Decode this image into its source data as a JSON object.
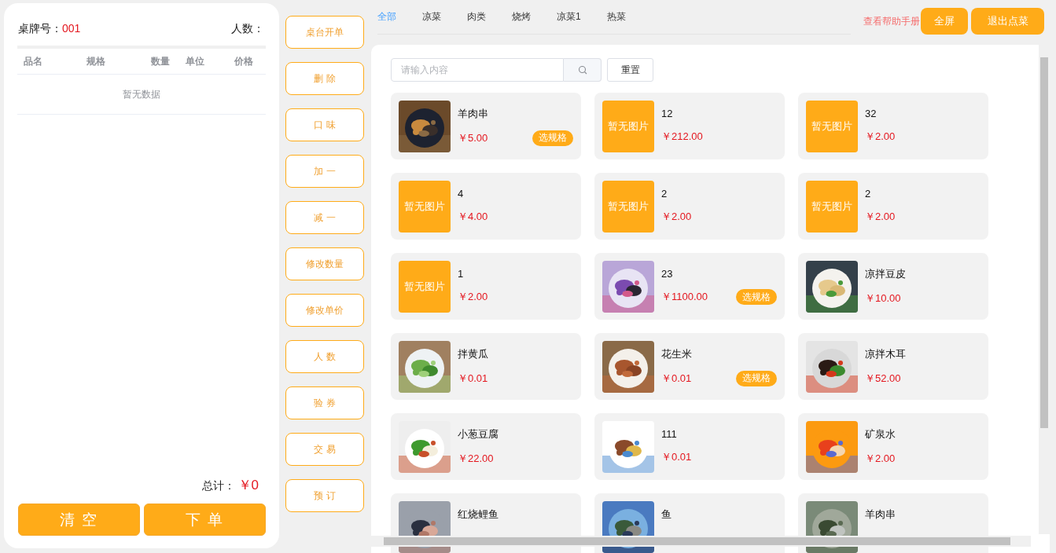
{
  "cart": {
    "table_label": "桌牌号：",
    "table_no": "001",
    "people_label": "人数：",
    "columns": [
      "品名",
      "规格",
      "数量",
      "单位",
      "价格"
    ],
    "empty_text": "暂无数据",
    "total_label": "总计：",
    "total": "￥0",
    "buttons": [
      "清 空",
      "下 单"
    ]
  },
  "actions": [
    "桌台开单",
    "删 除",
    "口 味",
    "加 一",
    "减 一",
    "修改数量",
    "修改单价",
    "人 数",
    "验 券",
    "交 易",
    "预 订"
  ],
  "tabs": [
    {
      "label": "全部",
      "selected": true
    },
    {
      "label": "凉菜",
      "selected": false
    },
    {
      "label": "肉类",
      "selected": false
    },
    {
      "label": "烧烤",
      "selected": false
    },
    {
      "label": "凉菜1",
      "selected": false
    },
    {
      "label": "热菜",
      "selected": false
    }
  ],
  "help_link": "查看帮助手册",
  "top_buttons": [
    "全屏",
    "退出点菜"
  ],
  "search": {
    "placeholder": "请输入内容",
    "reset": "重置"
  },
  "dishes": [
    {
      "name": "羊肉串",
      "price": "￥5.00",
      "spec": "选规格"
    },
    {
      "image": {
        "kind": "placeholder",
        "text": "暂无图片"
      },
      "name": "12",
      "price": "￥212.00"
    },
    {
      "image": {
        "kind": "placeholder",
        "text": "暂无图片"
      },
      "name": "32",
      "price": "￥2.00"
    },
    {
      "image": {
        "kind": "placeholder",
        "text": "暂无图片"
      },
      "name": "4",
      "price": "￥4.00"
    },
    {
      "image": {
        "kind": "placeholder",
        "text": "暂无图片"
      },
      "name": "2",
      "price": "￥2.00"
    },
    {
      "image": {
        "kind": "placeholder",
        "text": "暂无图片"
      },
      "name": "2",
      "price": "￥2.00"
    },
    {
      "image": {
        "kind": "placeholder",
        "text": "暂无图片"
      },
      "name": "1",
      "price": "￥2.00"
    },
    {
      "name": "23",
      "price": "￥1100.00",
      "spec": "选规格"
    },
    {
      "name": "凉拌豆皮",
      "price": "￥10.00"
    },
    {
      "name": "拌黄瓜",
      "price": "￥0.01"
    },
    {
      "name": "花生米",
      "price": "￥0.01",
      "spec": "选规格"
    },
    {
      "name": "凉拌木耳",
      "price": "￥52.00"
    },
    {
      "name": "小葱豆腐",
      "price": "￥22.00"
    },
    {
      "name": "111",
      "price": "￥0.01"
    },
    {
      "name": "矿泉水",
      "price": "￥2.00"
    },
    {
      "name": "红烧鲤鱼"
    },
    {
      "name": "鱼"
    },
    {
      "name": "羊肉串"
    }
  ]
}
